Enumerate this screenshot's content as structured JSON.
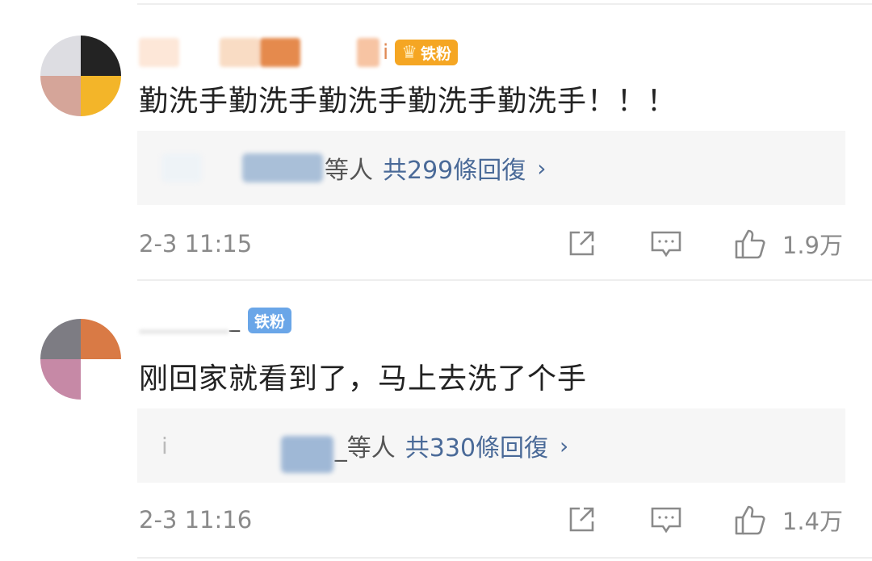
{
  "comments": [
    {
      "badge": "铁粉",
      "name_suffix": "i",
      "text": "勤洗手勤洗手勤洗手勤洗手勤洗手！！！",
      "reply_etc": "等人",
      "reply_count": "共299條回復",
      "reply_chevron": "›",
      "time": "2-3 11:15",
      "likes": "1.9万",
      "badge_color": "#f5a623"
    },
    {
      "badge": "铁粉",
      "name_suffix": "_",
      "text": "刚回家就看到了，马上去洗了个手",
      "reply_prefix": "i",
      "reply_etc": "_等人",
      "reply_count": "共330條回復",
      "reply_chevron": "›",
      "time": "2-3 11:16",
      "likes": "1.4万",
      "badge_color": "#6aa6e8"
    }
  ],
  "icons": [
    "share-icon",
    "comment-icon",
    "like-icon"
  ]
}
